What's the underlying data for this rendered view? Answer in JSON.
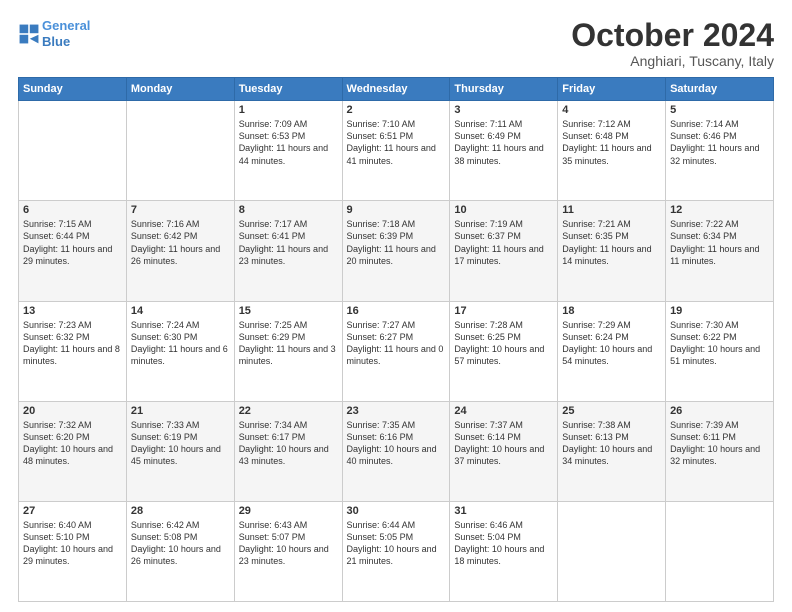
{
  "header": {
    "logo_line1": "General",
    "logo_line2": "Blue",
    "month": "October 2024",
    "location": "Anghiari, Tuscany, Italy"
  },
  "weekdays": [
    "Sunday",
    "Monday",
    "Tuesday",
    "Wednesday",
    "Thursday",
    "Friday",
    "Saturday"
  ],
  "weeks": [
    [
      {
        "day": "",
        "info": ""
      },
      {
        "day": "",
        "info": ""
      },
      {
        "day": "1",
        "info": "Sunrise: 7:09 AM\nSunset: 6:53 PM\nDaylight: 11 hours and 44 minutes."
      },
      {
        "day": "2",
        "info": "Sunrise: 7:10 AM\nSunset: 6:51 PM\nDaylight: 11 hours and 41 minutes."
      },
      {
        "day": "3",
        "info": "Sunrise: 7:11 AM\nSunset: 6:49 PM\nDaylight: 11 hours and 38 minutes."
      },
      {
        "day": "4",
        "info": "Sunrise: 7:12 AM\nSunset: 6:48 PM\nDaylight: 11 hours and 35 minutes."
      },
      {
        "day": "5",
        "info": "Sunrise: 7:14 AM\nSunset: 6:46 PM\nDaylight: 11 hours and 32 minutes."
      }
    ],
    [
      {
        "day": "6",
        "info": "Sunrise: 7:15 AM\nSunset: 6:44 PM\nDaylight: 11 hours and 29 minutes."
      },
      {
        "day": "7",
        "info": "Sunrise: 7:16 AM\nSunset: 6:42 PM\nDaylight: 11 hours and 26 minutes."
      },
      {
        "day": "8",
        "info": "Sunrise: 7:17 AM\nSunset: 6:41 PM\nDaylight: 11 hours and 23 minutes."
      },
      {
        "day": "9",
        "info": "Sunrise: 7:18 AM\nSunset: 6:39 PM\nDaylight: 11 hours and 20 minutes."
      },
      {
        "day": "10",
        "info": "Sunrise: 7:19 AM\nSunset: 6:37 PM\nDaylight: 11 hours and 17 minutes."
      },
      {
        "day": "11",
        "info": "Sunrise: 7:21 AM\nSunset: 6:35 PM\nDaylight: 11 hours and 14 minutes."
      },
      {
        "day": "12",
        "info": "Sunrise: 7:22 AM\nSunset: 6:34 PM\nDaylight: 11 hours and 11 minutes."
      }
    ],
    [
      {
        "day": "13",
        "info": "Sunrise: 7:23 AM\nSunset: 6:32 PM\nDaylight: 11 hours and 8 minutes."
      },
      {
        "day": "14",
        "info": "Sunrise: 7:24 AM\nSunset: 6:30 PM\nDaylight: 11 hours and 6 minutes."
      },
      {
        "day": "15",
        "info": "Sunrise: 7:25 AM\nSunset: 6:29 PM\nDaylight: 11 hours and 3 minutes."
      },
      {
        "day": "16",
        "info": "Sunrise: 7:27 AM\nSunset: 6:27 PM\nDaylight: 11 hours and 0 minutes."
      },
      {
        "day": "17",
        "info": "Sunrise: 7:28 AM\nSunset: 6:25 PM\nDaylight: 10 hours and 57 minutes."
      },
      {
        "day": "18",
        "info": "Sunrise: 7:29 AM\nSunset: 6:24 PM\nDaylight: 10 hours and 54 minutes."
      },
      {
        "day": "19",
        "info": "Sunrise: 7:30 AM\nSunset: 6:22 PM\nDaylight: 10 hours and 51 minutes."
      }
    ],
    [
      {
        "day": "20",
        "info": "Sunrise: 7:32 AM\nSunset: 6:20 PM\nDaylight: 10 hours and 48 minutes."
      },
      {
        "day": "21",
        "info": "Sunrise: 7:33 AM\nSunset: 6:19 PM\nDaylight: 10 hours and 45 minutes."
      },
      {
        "day": "22",
        "info": "Sunrise: 7:34 AM\nSunset: 6:17 PM\nDaylight: 10 hours and 43 minutes."
      },
      {
        "day": "23",
        "info": "Sunrise: 7:35 AM\nSunset: 6:16 PM\nDaylight: 10 hours and 40 minutes."
      },
      {
        "day": "24",
        "info": "Sunrise: 7:37 AM\nSunset: 6:14 PM\nDaylight: 10 hours and 37 minutes."
      },
      {
        "day": "25",
        "info": "Sunrise: 7:38 AM\nSunset: 6:13 PM\nDaylight: 10 hours and 34 minutes."
      },
      {
        "day": "26",
        "info": "Sunrise: 7:39 AM\nSunset: 6:11 PM\nDaylight: 10 hours and 32 minutes."
      }
    ],
    [
      {
        "day": "27",
        "info": "Sunrise: 6:40 AM\nSunset: 5:10 PM\nDaylight: 10 hours and 29 minutes."
      },
      {
        "day": "28",
        "info": "Sunrise: 6:42 AM\nSunset: 5:08 PM\nDaylight: 10 hours and 26 minutes."
      },
      {
        "day": "29",
        "info": "Sunrise: 6:43 AM\nSunset: 5:07 PM\nDaylight: 10 hours and 23 minutes."
      },
      {
        "day": "30",
        "info": "Sunrise: 6:44 AM\nSunset: 5:05 PM\nDaylight: 10 hours and 21 minutes."
      },
      {
        "day": "31",
        "info": "Sunrise: 6:46 AM\nSunset: 5:04 PM\nDaylight: 10 hours and 18 minutes."
      },
      {
        "day": "",
        "info": ""
      },
      {
        "day": "",
        "info": ""
      }
    ]
  ]
}
